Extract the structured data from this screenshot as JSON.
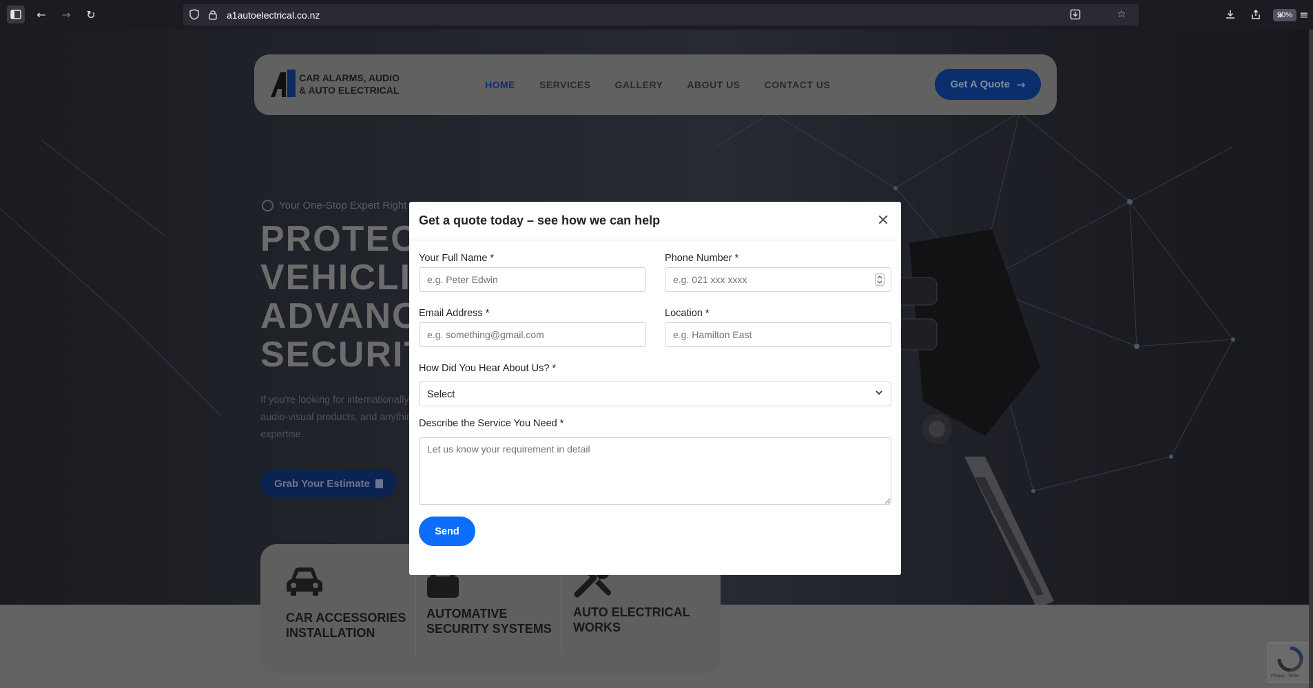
{
  "browser": {
    "url": "a1autoelectrical.co.nz",
    "zoom": "90%",
    "icons": [
      "sidebar-icon",
      "back-icon",
      "forward-icon",
      "reload-icon",
      "shield-icon",
      "lock-icon",
      "reader-download-icon",
      "star-icon",
      "download-icon",
      "share-icon",
      "overflow-icon",
      "menu-icon"
    ]
  },
  "nav": {
    "logo_line1": "CAR ALARMS, AUDIO",
    "logo_line2": "& AUTO ELECTRICAL",
    "links": [
      "HOME",
      "SERVICES",
      "GALLERY",
      "ABOUT US",
      "CONTACT US"
    ],
    "active_link": "HOME",
    "quote_button": "Get A Quote"
  },
  "hero": {
    "tagline": "Your One-Stop Expert Right H",
    "title_lines": [
      "PROTEC",
      "VEHICLI",
      "ADVANC",
      "SECURIT"
    ],
    "description": "If you're looking for internationally audio-visual products, and anythin expertise.",
    "estimate_button": "Grab Your Estimate"
  },
  "cards": [
    {
      "icon": "car-icon",
      "line1": "CAR ACCESSORIES",
      "line2": "INSTALLATION"
    },
    {
      "icon": "lock-icon",
      "line1": "AUTOMATIVE",
      "line2": "SECURITY SYSTEMS"
    },
    {
      "icon": "tools-icon",
      "line1": "AUTO ELECTRICAL",
      "line2": "WORKS"
    }
  ],
  "recaptcha": {
    "text": "Privacy - Terms"
  },
  "modal": {
    "title": "Get a quote today – see how we can help",
    "full_name": {
      "label": "Your Full Name *",
      "placeholder": "e.g. Peter Edwin"
    },
    "phone": {
      "label": "Phone Number *",
      "placeholder": "e.g. 021 xxx xxxx"
    },
    "email": {
      "label": "Email Address *",
      "placeholder": "e.g. something@gmail.com"
    },
    "location": {
      "label": "Location *",
      "placeholder": "e.g. Hamilton East"
    },
    "hear_about": {
      "label": "How Did You Hear About Us? *",
      "value": "Select"
    },
    "service": {
      "label": "Describe the Service You Need *",
      "placeholder": "Let us know your requirement in detail"
    },
    "send_button": "Send"
  },
  "colors": {
    "modal_primary": "#0d6efd",
    "brand_navy": "#0a2e6b",
    "overlay_bg": "#1b1b1f"
  }
}
